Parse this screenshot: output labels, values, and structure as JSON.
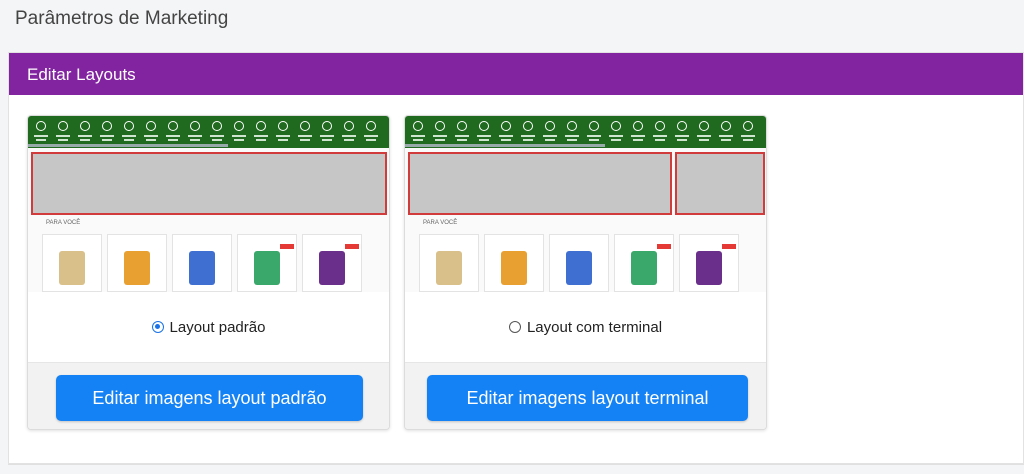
{
  "page": {
    "title": "Parâmetros de Marketing"
  },
  "panel": {
    "header": "Editar Layouts"
  },
  "layouts": [
    {
      "radio_label": "Layout padrão",
      "selected": true,
      "button_label": "Editar imagens layout padrão",
      "preview": {
        "section_label": "PARA VOCÊ",
        "banners": 1
      }
    },
    {
      "radio_label": "Layout com terminal",
      "selected": false,
      "button_label": "Editar imagens layout terminal",
      "preview": {
        "section_label": "PARA VOCÊ",
        "banners": 2
      }
    }
  ],
  "colors": {
    "header": "#8224a0",
    "nav": "#1f6a1f",
    "button": "#1482f4",
    "banner_border": "#d23b3b"
  }
}
